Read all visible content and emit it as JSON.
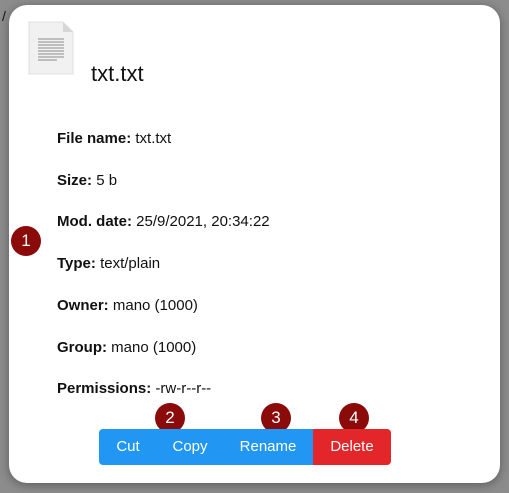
{
  "background": {
    "path_char": "/"
  },
  "file": {
    "title": "txt.txt",
    "icon": "text-file-icon"
  },
  "details": [
    {
      "label": "File name:",
      "value": "txt.txt"
    },
    {
      "label": "Size:",
      "value": "5 b"
    },
    {
      "label": "Mod. date:",
      "value": "25/9/2021, 20:34:22"
    },
    {
      "label": "Type:",
      "value": "text/plain"
    },
    {
      "label": "Owner:",
      "value": "mano (1000)"
    },
    {
      "label": "Group:",
      "value": "mano (1000)"
    },
    {
      "label": "Permissions:",
      "value": "-rw-r--r--"
    }
  ],
  "actions": {
    "cut": "Cut",
    "copy": "Copy",
    "rename": "Rename",
    "delete": "Delete"
  },
  "badges": [
    "1",
    "2",
    "3",
    "4"
  ],
  "colors": {
    "primary_button": "#2196f3",
    "danger_button": "#e3262a",
    "badge": "#8b0a0a"
  }
}
